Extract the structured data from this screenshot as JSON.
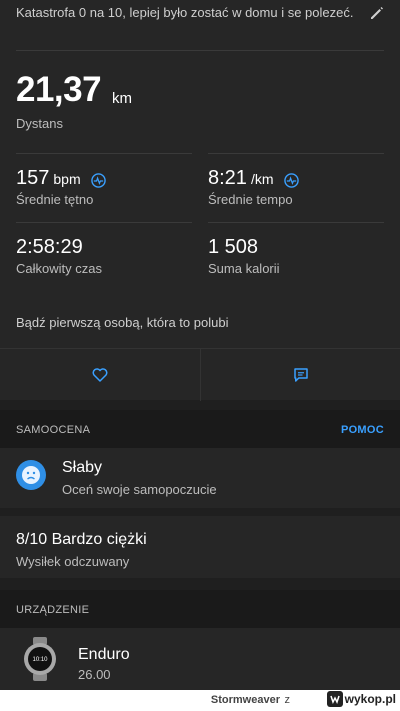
{
  "activity": {
    "description": "Katastrofa 0 na 10, lepiej było zostać w domu i se polezeć.",
    "distance": {
      "value": "21,37",
      "unit": "km",
      "label": "Dystans"
    },
    "heart_rate": {
      "value": "157",
      "unit": "bpm",
      "label": "Średnie tętno"
    },
    "pace": {
      "value": "8:21",
      "unit": "/km",
      "label": "Średnie tempo"
    },
    "time": {
      "value": "2:58:29",
      "label": "Całkowity czas"
    },
    "calories": {
      "value": "1 508",
      "label": "Suma kalorii"
    },
    "likes_text": "Bądź pierwszą osobą, która to polubi"
  },
  "self_eval": {
    "section_title": "SAMOOCENA",
    "help_link": "POMOC",
    "mood_title": "Słaby",
    "mood_sub": "Oceń swoje samopoczucie",
    "effort_title": "8/10 Bardzo ciężki",
    "effort_sub": "Wysiłek odczuwany"
  },
  "device": {
    "section_title": "URZĄDZENIE",
    "name": "Enduro",
    "version": "26.00",
    "watch_face": "10:10"
  },
  "footer": {
    "user": "Stormweaver",
    "z": "z",
    "brand": "wykop.pl"
  },
  "icons": [
    "edit-pencil-icon",
    "heart-rate-icon",
    "heart-icon",
    "comment-icon",
    "sad-face-icon",
    "watch-icon"
  ],
  "colors": {
    "accent": "#3aa0ff",
    "background": "#1f1f1f",
    "card": "#262626"
  }
}
